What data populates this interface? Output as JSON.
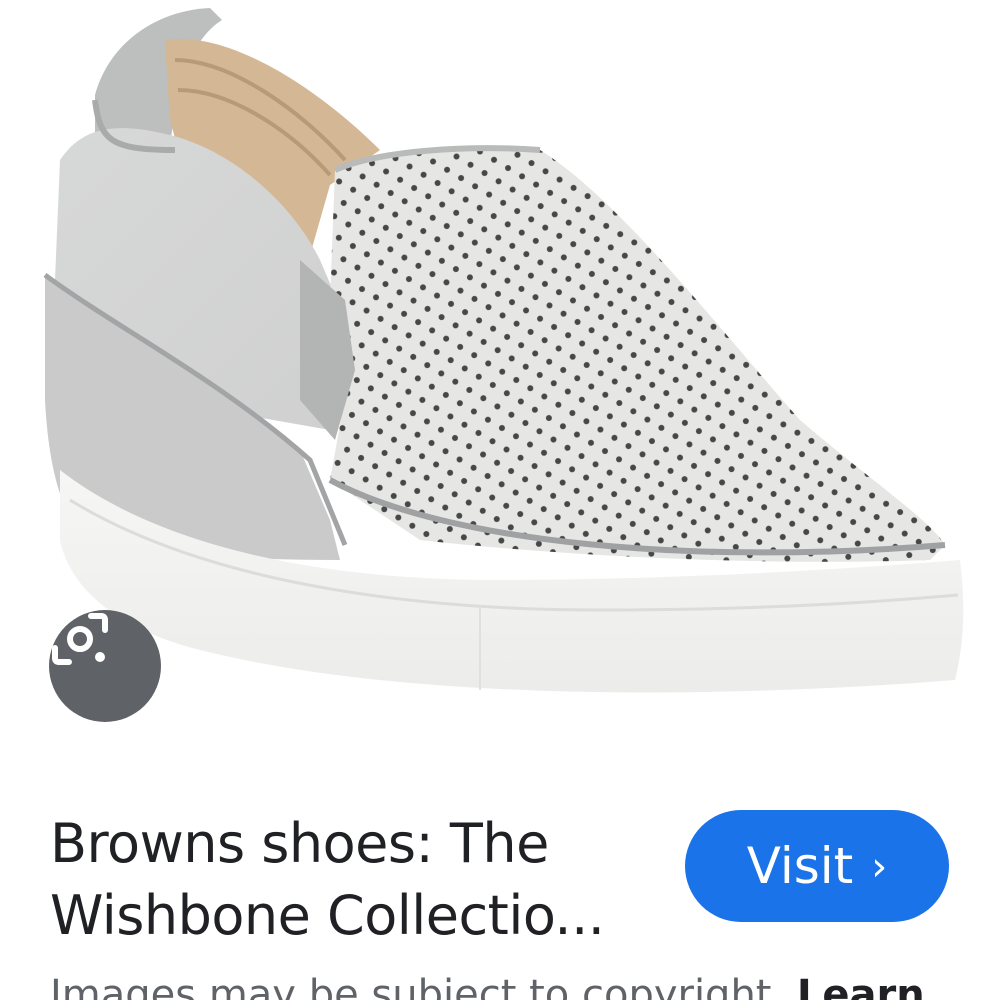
{
  "image": {
    "subject": "grey perforated slip-on wedge sneaker"
  },
  "lens": {
    "icon": "google-lens-icon",
    "bg_color": "#5f6368"
  },
  "result": {
    "title_line1": "Browns shoes: The",
    "title_line2": "Wishbone Collectio...",
    "visit_label": "Visit",
    "visit_chevron": "›",
    "visit_color": "#1a73e8"
  },
  "footer": {
    "disclaimer": "Images may be subject to copyright.",
    "learn_more": "Learn"
  }
}
